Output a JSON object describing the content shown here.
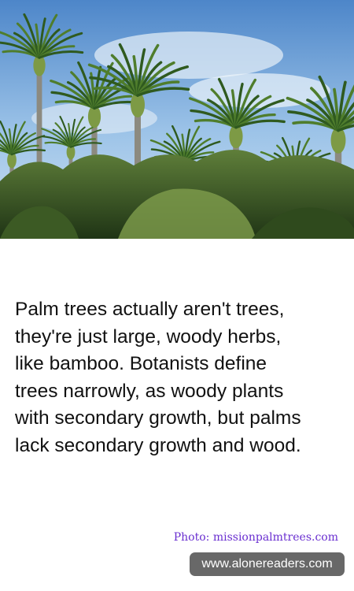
{
  "photo": {
    "subject": "nikau-palm-trees"
  },
  "fact": {
    "lines": [
      "Palm trees actually aren't trees,",
      "they're just large, woody herbs,",
      "like bamboo. Botanists define",
      "trees narrowly, as woody plants",
      "with secondary growth, but palms",
      "lack secondary growth and wood."
    ]
  },
  "credit": {
    "text": "Photo: missionpalmtrees.com"
  },
  "site": {
    "text": "www.alonereaders.com"
  },
  "colors": {
    "text": "#111111",
    "credit": "#6a2fd0",
    "badge": "#686868"
  }
}
